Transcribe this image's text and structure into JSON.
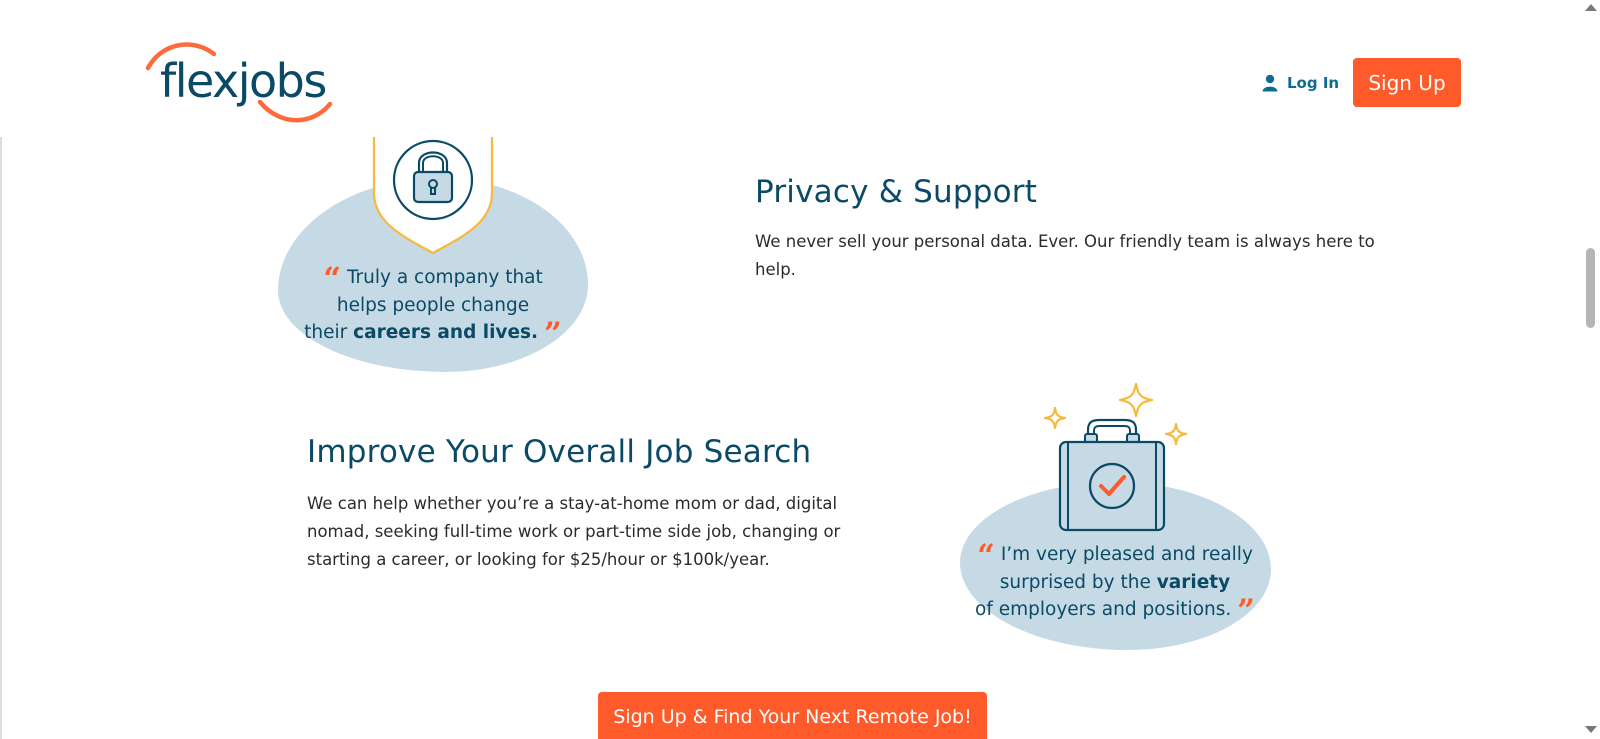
{
  "header": {
    "logo_text": "flexjobs",
    "login_label": "Log In",
    "signup_label": "Sign Up"
  },
  "privacy": {
    "heading": "Privacy & Support",
    "body": "We never sell your personal data. Ever. Our friendly team is always here to help.",
    "quote_line1": "Truly a company that",
    "quote_line2": "helps people change",
    "quote_line3_start": "their ",
    "quote_line3_bold": "careers and lives."
  },
  "improve": {
    "heading": "Improve Your Overall Job Search",
    "body": "We can help whether you’re a stay-at-home mom or dad, digital nomad, seeking full-time work or part-time side job, changing or starting a career, or looking for $25/hour or $100k/year.",
    "quote_line1": "I’m very pleased and really",
    "quote_line2_start": "surprised by the ",
    "quote_line2_bold": "variety",
    "quote_line3": "of employers and positions."
  },
  "cta": {
    "label": "Sign Up & Find Your Next Remote Job!"
  },
  "quote_open": "“",
  "quote_close": "”",
  "colors": {
    "brand_orange": "#ff5a29",
    "brand_navy": "#0b4a66",
    "link_blue": "#0f6b93",
    "blob_blue": "#c6dae5",
    "accent_yellow": "#f6b93b"
  },
  "icons": {
    "user": "user-icon",
    "lock": "lock-icon",
    "briefcase": "briefcase-check-icon",
    "sparkle": "sparkle-icon"
  }
}
